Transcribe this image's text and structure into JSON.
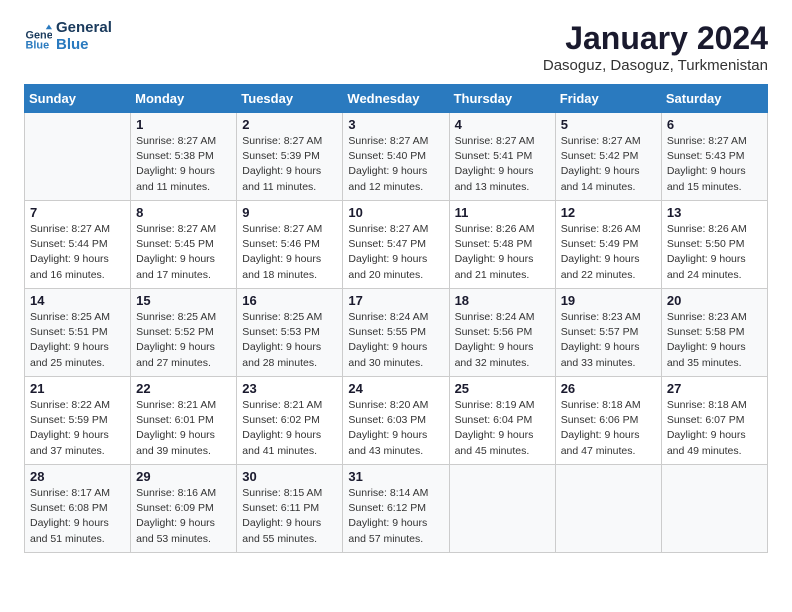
{
  "header": {
    "logo_line1": "General",
    "logo_line2": "Blue",
    "month": "January 2024",
    "location": "Dasoguz, Dasoguz, Turkmenistan"
  },
  "days_of_week": [
    "Sunday",
    "Monday",
    "Tuesday",
    "Wednesday",
    "Thursday",
    "Friday",
    "Saturday"
  ],
  "weeks": [
    [
      {
        "day": "",
        "info": ""
      },
      {
        "day": "1",
        "info": "Sunrise: 8:27 AM\nSunset: 5:38 PM\nDaylight: 9 hours\nand 11 minutes."
      },
      {
        "day": "2",
        "info": "Sunrise: 8:27 AM\nSunset: 5:39 PM\nDaylight: 9 hours\nand 11 minutes."
      },
      {
        "day": "3",
        "info": "Sunrise: 8:27 AM\nSunset: 5:40 PM\nDaylight: 9 hours\nand 12 minutes."
      },
      {
        "day": "4",
        "info": "Sunrise: 8:27 AM\nSunset: 5:41 PM\nDaylight: 9 hours\nand 13 minutes."
      },
      {
        "day": "5",
        "info": "Sunrise: 8:27 AM\nSunset: 5:42 PM\nDaylight: 9 hours\nand 14 minutes."
      },
      {
        "day": "6",
        "info": "Sunrise: 8:27 AM\nSunset: 5:43 PM\nDaylight: 9 hours\nand 15 minutes."
      }
    ],
    [
      {
        "day": "7",
        "info": "Sunrise: 8:27 AM\nSunset: 5:44 PM\nDaylight: 9 hours\nand 16 minutes."
      },
      {
        "day": "8",
        "info": "Sunrise: 8:27 AM\nSunset: 5:45 PM\nDaylight: 9 hours\nand 17 minutes."
      },
      {
        "day": "9",
        "info": "Sunrise: 8:27 AM\nSunset: 5:46 PM\nDaylight: 9 hours\nand 18 minutes."
      },
      {
        "day": "10",
        "info": "Sunrise: 8:27 AM\nSunset: 5:47 PM\nDaylight: 9 hours\nand 20 minutes."
      },
      {
        "day": "11",
        "info": "Sunrise: 8:26 AM\nSunset: 5:48 PM\nDaylight: 9 hours\nand 21 minutes."
      },
      {
        "day": "12",
        "info": "Sunrise: 8:26 AM\nSunset: 5:49 PM\nDaylight: 9 hours\nand 22 minutes."
      },
      {
        "day": "13",
        "info": "Sunrise: 8:26 AM\nSunset: 5:50 PM\nDaylight: 9 hours\nand 24 minutes."
      }
    ],
    [
      {
        "day": "14",
        "info": "Sunrise: 8:25 AM\nSunset: 5:51 PM\nDaylight: 9 hours\nand 25 minutes."
      },
      {
        "day": "15",
        "info": "Sunrise: 8:25 AM\nSunset: 5:52 PM\nDaylight: 9 hours\nand 27 minutes."
      },
      {
        "day": "16",
        "info": "Sunrise: 8:25 AM\nSunset: 5:53 PM\nDaylight: 9 hours\nand 28 minutes."
      },
      {
        "day": "17",
        "info": "Sunrise: 8:24 AM\nSunset: 5:55 PM\nDaylight: 9 hours\nand 30 minutes."
      },
      {
        "day": "18",
        "info": "Sunrise: 8:24 AM\nSunset: 5:56 PM\nDaylight: 9 hours\nand 32 minutes."
      },
      {
        "day": "19",
        "info": "Sunrise: 8:23 AM\nSunset: 5:57 PM\nDaylight: 9 hours\nand 33 minutes."
      },
      {
        "day": "20",
        "info": "Sunrise: 8:23 AM\nSunset: 5:58 PM\nDaylight: 9 hours\nand 35 minutes."
      }
    ],
    [
      {
        "day": "21",
        "info": "Sunrise: 8:22 AM\nSunset: 5:59 PM\nDaylight: 9 hours\nand 37 minutes."
      },
      {
        "day": "22",
        "info": "Sunrise: 8:21 AM\nSunset: 6:01 PM\nDaylight: 9 hours\nand 39 minutes."
      },
      {
        "day": "23",
        "info": "Sunrise: 8:21 AM\nSunset: 6:02 PM\nDaylight: 9 hours\nand 41 minutes."
      },
      {
        "day": "24",
        "info": "Sunrise: 8:20 AM\nSunset: 6:03 PM\nDaylight: 9 hours\nand 43 minutes."
      },
      {
        "day": "25",
        "info": "Sunrise: 8:19 AM\nSunset: 6:04 PM\nDaylight: 9 hours\nand 45 minutes."
      },
      {
        "day": "26",
        "info": "Sunrise: 8:18 AM\nSunset: 6:06 PM\nDaylight: 9 hours\nand 47 minutes."
      },
      {
        "day": "27",
        "info": "Sunrise: 8:18 AM\nSunset: 6:07 PM\nDaylight: 9 hours\nand 49 minutes."
      }
    ],
    [
      {
        "day": "28",
        "info": "Sunrise: 8:17 AM\nSunset: 6:08 PM\nDaylight: 9 hours\nand 51 minutes."
      },
      {
        "day": "29",
        "info": "Sunrise: 8:16 AM\nSunset: 6:09 PM\nDaylight: 9 hours\nand 53 minutes."
      },
      {
        "day": "30",
        "info": "Sunrise: 8:15 AM\nSunset: 6:11 PM\nDaylight: 9 hours\nand 55 minutes."
      },
      {
        "day": "31",
        "info": "Sunrise: 8:14 AM\nSunset: 6:12 PM\nDaylight: 9 hours\nand 57 minutes."
      },
      {
        "day": "",
        "info": ""
      },
      {
        "day": "",
        "info": ""
      },
      {
        "day": "",
        "info": ""
      }
    ]
  ]
}
